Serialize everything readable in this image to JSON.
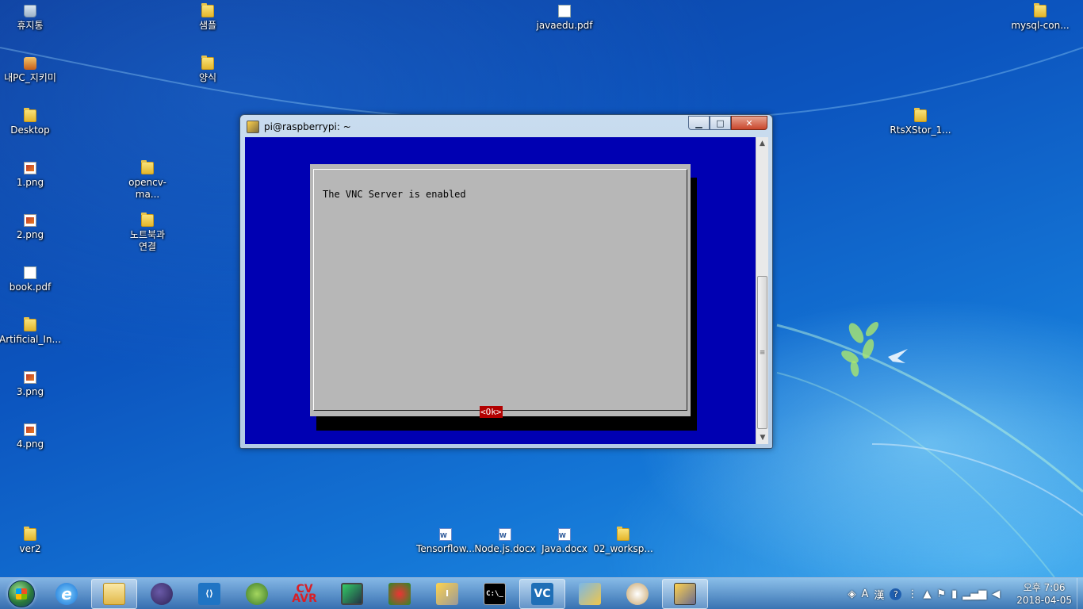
{
  "desktop": {
    "icons": [
      {
        "label": "휴지통",
        "type": "trash"
      },
      {
        "label": "내PC_지키미",
        "type": "pc"
      },
      {
        "label": "Desktop",
        "type": "folder"
      },
      {
        "label": "1.png",
        "type": "png"
      },
      {
        "label": "2.png",
        "type": "png"
      },
      {
        "label": "book.pdf",
        "type": "file"
      },
      {
        "label": "Artificial_In...",
        "type": "folder"
      },
      {
        "label": "3.png",
        "type": "png"
      },
      {
        "label": "4.png",
        "type": "png"
      },
      {
        "label": "ver2",
        "type": "folder"
      },
      {
        "label": "샘플",
        "type": "folder"
      },
      {
        "label": "양식",
        "type": "folder"
      },
      {
        "label": "opencv-ma...",
        "type": "folder"
      },
      {
        "label": "노트북과\n연결",
        "type": "folder"
      },
      {
        "label": "javaedu.pdf",
        "type": "file"
      },
      {
        "label": "mysql-con...",
        "type": "folder"
      },
      {
        "label": "RtsXStor_1...",
        "type": "folder"
      },
      {
        "label": "Tensorflow...",
        "type": "doc"
      },
      {
        "label": "Node.js.docx",
        "type": "doc"
      },
      {
        "label": "Java.docx",
        "type": "doc"
      },
      {
        "label": "02_worksp...",
        "type": "folder"
      }
    ]
  },
  "putty": {
    "title": "pi@raspberrypi: ~",
    "buttons": {
      "min": "▁",
      "max": "□",
      "close": "✕"
    },
    "dialog": {
      "message": "The VNC Server is enabled",
      "ok_label": "<Ok>"
    }
  },
  "taskbar": {
    "apps": [
      {
        "name": "internet-explorer",
        "glyph": "e"
      },
      {
        "name": "file-explorer",
        "glyph": ""
      },
      {
        "name": "eclipse",
        "glyph": ""
      },
      {
        "name": "visual-studio-code",
        "glyph": "⟨⟩"
      },
      {
        "name": "android-studio",
        "glyph": ""
      },
      {
        "name": "cvavr",
        "glyph": "CV\nAVR"
      },
      {
        "name": "circuit-designer",
        "glyph": ""
      },
      {
        "name": "network-tool",
        "glyph": ""
      },
      {
        "name": "tool-app",
        "glyph": "I"
      },
      {
        "name": "command-prompt",
        "glyph": "C:\\_"
      },
      {
        "name": "vnc-viewer",
        "glyph": "VC"
      },
      {
        "name": "control-panel",
        "glyph": ""
      },
      {
        "name": "paint",
        "glyph": ""
      },
      {
        "name": "putty",
        "glyph": ""
      }
    ],
    "tray": {
      "ime_a": "A",
      "ime_han": "漢",
      "help": "?",
      "clock_time": "오후 7:06",
      "clock_date": "2018-04-05"
    }
  }
}
